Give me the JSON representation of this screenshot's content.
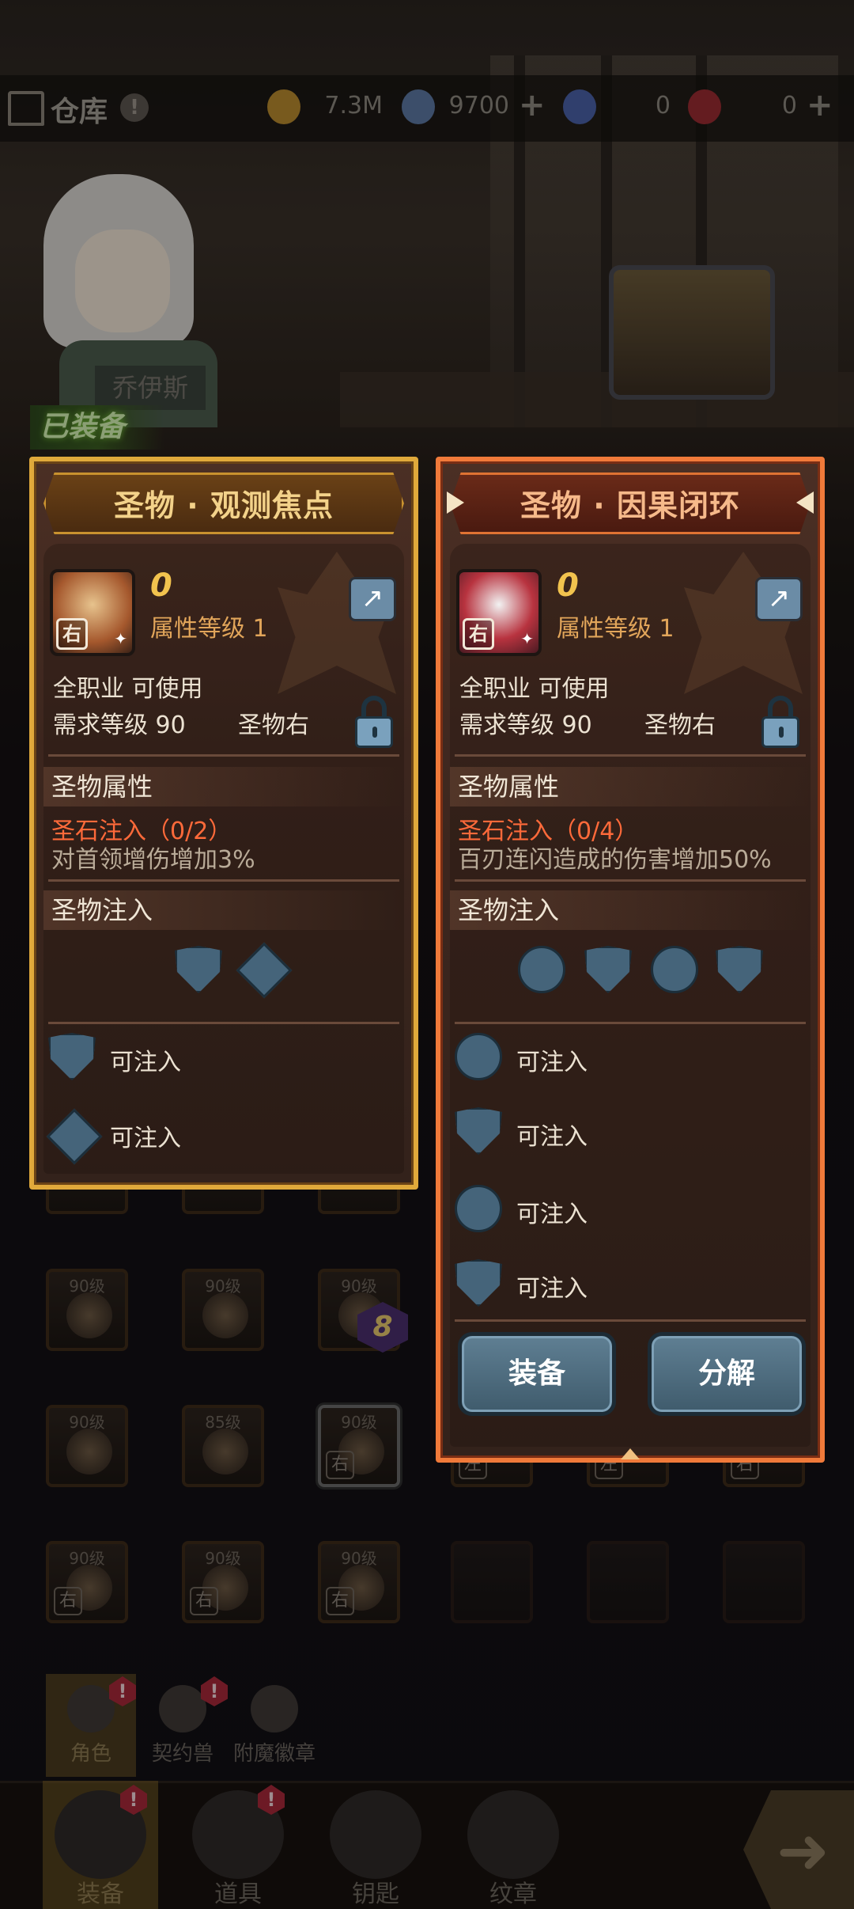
{
  "top_bar": {
    "warehouse_label": "仓库",
    "warehouse_alert": "!",
    "resources": [
      {
        "icon": "gold-coin-icon",
        "value": "7.3M",
        "has_plus": false
      },
      {
        "icon": "crystal-icon",
        "value": "9700",
        "has_plus": true
      },
      {
        "icon": "blue-ticket-icon",
        "value": "0",
        "has_plus": false
      },
      {
        "icon": "red-ticket-icon",
        "value": "0",
        "has_plus": true
      }
    ],
    "plus": "+"
  },
  "hero": {
    "name": "乔伊斯",
    "equipped_tag": "已装备"
  },
  "left_panel": {
    "title": "圣物 · 观测焦点",
    "hand": "右",
    "enhance": "0",
    "attr_level": "属性等级 1",
    "class_req": "全职业 可使用",
    "level_req": "需求等级 90",
    "slot": "圣物右",
    "attr_section": "圣物属性",
    "stone_inject": "圣石注入（0/2）",
    "effect": "对首领增伤增加3%",
    "inject_section": "圣物注入",
    "sockets": [
      "shield",
      "diamond"
    ],
    "rows": [
      {
        "shape": "shield",
        "label": "可注入"
      },
      {
        "shape": "diamond",
        "label": "可注入"
      }
    ]
  },
  "right_panel": {
    "title": "圣物 · 因果闭环",
    "hand": "右",
    "enhance": "0",
    "attr_level": "属性等级 1",
    "class_req": "全职业 可使用",
    "level_req": "需求等级 90",
    "slot": "圣物右",
    "attr_section": "圣物属性",
    "stone_inject": "圣石注入（0/4）",
    "effect": "百刃连闪造成的伤害增加50%",
    "inject_section": "圣物注入",
    "sockets": [
      "circle",
      "shield",
      "circle",
      "shield"
    ],
    "rows": [
      {
        "shape": "circle",
        "label": "可注入"
      },
      {
        "shape": "shield",
        "label": "可注入"
      },
      {
        "shape": "circle",
        "label": "可注入"
      },
      {
        "shape": "shield",
        "label": "可注入"
      }
    ],
    "equip_button": "装备",
    "decompose_button": "分解"
  },
  "inventory": {
    "rows": [
      [
        {
          "level": "90级",
          "hand": ""
        },
        {
          "level": "90级",
          "hand": ""
        },
        {
          "level": "90级",
          "hand": ""
        }
      ],
      [
        {
          "level": "90级",
          "hand": ""
        },
        {
          "level": "85级",
          "hand": ""
        },
        {
          "level": "90级",
          "hand": "右"
        }
      ],
      [
        {
          "level": "90级",
          "hand": "右"
        },
        {
          "level": "90级",
          "hand": "右"
        },
        {
          "level": "90级",
          "hand": "右"
        }
      ]
    ],
    "badge": "8",
    "partial_hands": [
      "左",
      "左",
      "右"
    ]
  },
  "category_tabs": [
    {
      "label": "角色",
      "alert": true,
      "active": true
    },
    {
      "label": "契约兽",
      "alert": true,
      "active": false
    },
    {
      "label": "附魔徽章",
      "alert": false,
      "active": false
    }
  ],
  "bottom_nav": [
    {
      "label": "装备",
      "alert": true,
      "active": true
    },
    {
      "label": "道具",
      "alert": true,
      "active": false
    },
    {
      "label": "钥匙",
      "alert": false,
      "active": false
    },
    {
      "label": "纹章",
      "alert": false,
      "active": false
    }
  ],
  "alert_mark": "!",
  "colors": {
    "left_border": "#e0a93b",
    "right_border": "#f07a3a",
    "accent_red": "#ff6a3a",
    "button_blue": "#4f6e81"
  }
}
